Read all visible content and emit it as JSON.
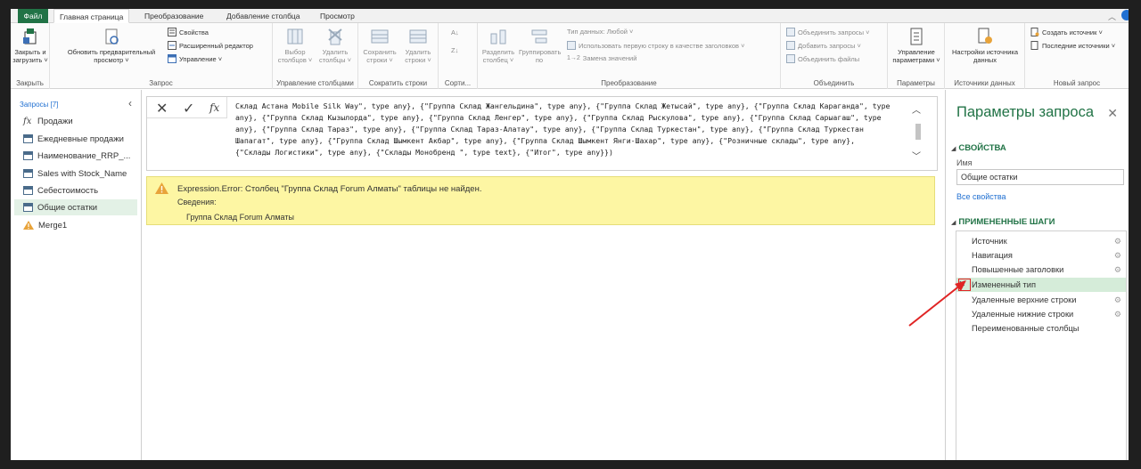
{
  "tabs": {
    "file": "Файл",
    "home": "Главная страница",
    "transform": "Преобразование",
    "add_column": "Добавление столбца",
    "view": "Просмотр"
  },
  "ribbon": {
    "close_group": {
      "label": "Закрыть",
      "close_load": "Закрыть и загрузить ˅"
    },
    "query_group": {
      "label": "Запрос",
      "refresh_preview": "Обновить предварительный просмотр ˅",
      "properties": "Свойства",
      "advanced_editor": "Расширенный редактор",
      "manage": "Управление ˅"
    },
    "manage_columns_group": {
      "label": "Управление столбцами",
      "choose_columns": "Выбор столбцов ˅",
      "remove_columns": "Удалить столбцы ˅"
    },
    "reduce_rows_group": {
      "label": "Сократить строки",
      "keep_rows": "Сохранить строки ˅",
      "remove_rows": "Удалить строки ˅"
    },
    "sort_group": {
      "label": "Сорти..."
    },
    "transform_group": {
      "label": "Преобразование",
      "split_column": "Разделить столбец ˅",
      "group_by": "Группировать по",
      "data_type": "Тип данных: Любой ˅",
      "use_first_row": "Использовать первую строку в качестве заголовков ˅",
      "replace_values": "Замена значений"
    },
    "combine_group": {
      "label": "Объединить",
      "merge_queries": "Объединить запросы ˅",
      "append_queries": "Добавить запросы ˅",
      "combine_files": "Объединить файлы"
    },
    "params_group": {
      "label": "Параметры",
      "manage_params": "Управление параметрами ˅"
    },
    "data_sources_group": {
      "label": "Источники данных",
      "source_settings": "Настройки источника данных"
    },
    "new_query_group": {
      "label": "Новый запрос",
      "new_source": "Создать источник ˅",
      "recent_sources": "Последние источники ˅"
    }
  },
  "queries_panel": {
    "header": "Запросы [7]",
    "items": [
      {
        "label": "Продажи",
        "icon": "fx-icon"
      },
      {
        "label": "Ежедневные продажи",
        "icon": "table-icon"
      },
      {
        "label": "Наименование_RRP_...",
        "icon": "table-icon"
      },
      {
        "label": "Sales with Stock_Name",
        "icon": "table-icon"
      },
      {
        "label": "Себестоимость",
        "icon": "table-icon"
      },
      {
        "label": "Общие остатки",
        "icon": "table-icon",
        "selected": true
      },
      {
        "label": "Merge1",
        "icon": "warning-icon"
      }
    ]
  },
  "formula_bar": {
    "text": "Склад Астана Mobile Silk Way\", type any}, {\"Группа Склад Жангельдина\", type any}, {\"Группа Склад Жетысай\", type any}, {\"Группа Склад Караганда\", type any}, {\"Группа Склад Кызылорда\", type any}, {\"Группа Склад Ленгер\", type any}, {\"Группа Склад Рыскулова\", type any}, {\"Группа Склад Сарыагаш\", type any}, {\"Группа Склад Тараз\", type any}, {\"Группа Склад Тараз-Алатау\", type any}, {\"Группа Склад Туркестан\", type any}, {\"Группа Склад Туркестан Шапагат\", type any}, {\"Группа Склад Шымкент Акбар\", type any}, {\"Группа Склад Шымкент Янги-Шахар\", type any}, {\"Розничные склады\", type any}, {\"Склады Логистики\", type any}, {\"Склады Монобренд \", type text}, {\"Итог\", type any}})"
  },
  "error": {
    "title": "Expression.Error: Столбец \"Группа Склад Forum Алматы\" таблицы не найден.",
    "detail_label": "Сведения:",
    "detail_value": "Группа Склад Forum Алматы"
  },
  "query_settings": {
    "title": "Параметры запроса",
    "properties_header": "СВОЙСТВА",
    "name_label": "Имя",
    "name_value": "Общие остатки",
    "all_properties": "Все свойства",
    "applied_steps_header": "ПРИМЕНЕННЫЕ ШАГИ",
    "steps": [
      {
        "label": "Источник",
        "gear": true
      },
      {
        "label": "Навигация",
        "gear": true
      },
      {
        "label": "Повышенные заголовки",
        "gear": true
      },
      {
        "label": "Измененный тип",
        "gear": false,
        "selected": true
      },
      {
        "label": "Удаленные верхние строки",
        "gear": true
      },
      {
        "label": "Удаленные нижние строки",
        "gear": true
      },
      {
        "label": "Переименованные столбцы",
        "gear": false
      }
    ]
  },
  "colors": {
    "accent": "#217346",
    "link": "#1f6fd1",
    "error_bg": "#fdf6a3",
    "selected_bg": "#d5ecd9",
    "annotation": "#e02424"
  }
}
